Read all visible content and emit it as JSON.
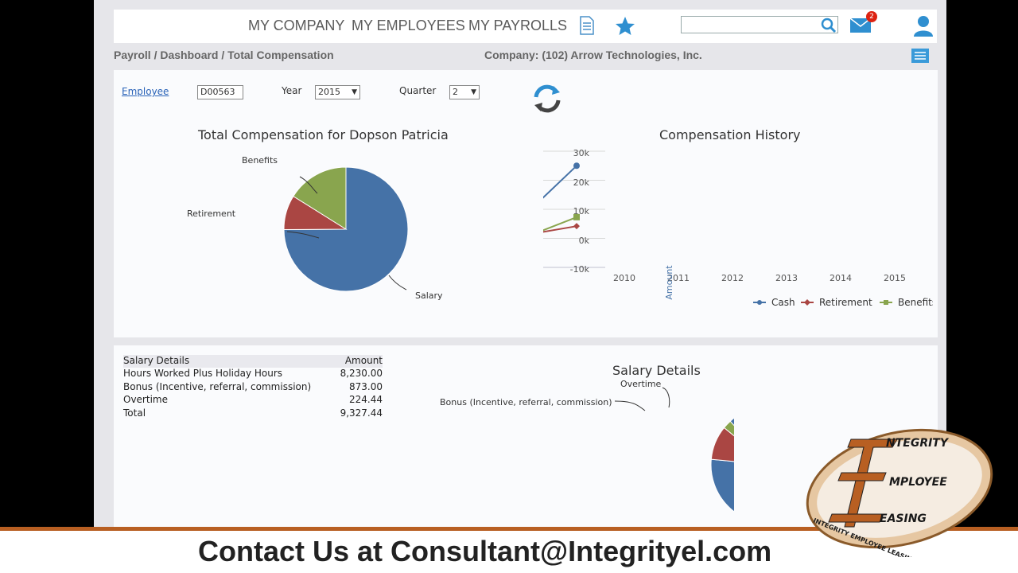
{
  "nav": {
    "links": [
      "MY COMPANY",
      "MY EMPLOYEES",
      "MY PAYROLLS"
    ],
    "icons": [
      "document-icon",
      "star-icon",
      "search-icon",
      "mail-icon",
      "user-icon"
    ],
    "mail_badge": "2",
    "search_value": ""
  },
  "breadcrumb": "Payroll / Dashboard / Total Compensation",
  "company": "Company: (102) Arrow Technologies, Inc.",
  "filters": {
    "employee_label": "Employee",
    "employee_value": "D00563",
    "year_label": "Year",
    "year_value": "2015",
    "quarter_label": "Quarter",
    "quarter_value": "2"
  },
  "pie1": {
    "title": "Total Compensation for Dopson Patricia",
    "labels": [
      "Salary",
      "Retirement",
      "Benefits"
    ]
  },
  "history": {
    "title": "Compensation History",
    "ylabel": "Amount",
    "yticks": [
      "30k",
      "20k",
      "10k",
      "0k",
      "-10k"
    ],
    "xticks": [
      "2010",
      "2011",
      "2012",
      "2013",
      "2014",
      "2015"
    ],
    "legend": [
      "Cash",
      "Retirement",
      "Benefits"
    ]
  },
  "salary_table": {
    "header": [
      "Salary Details",
      "Amount"
    ],
    "rows": [
      [
        "Hours Worked Plus Holiday Hours",
        "8,230.00"
      ],
      [
        "Bonus (Incentive, referral, commission)",
        "873.00"
      ],
      [
        "Overtime",
        "224.44"
      ],
      [
        "Total",
        "9,327.44"
      ]
    ]
  },
  "pie2": {
    "title": "Salary Details",
    "labels": [
      "Overtime",
      "Bonus (Incentive, referral, commission)"
    ]
  },
  "chart_data": [
    {
      "type": "pie",
      "title": "Total Compensation for Dopson Patricia",
      "categories": [
        "Salary",
        "Retirement",
        "Benefits"
      ],
      "values": [
        74.9,
        9.0,
        16.1
      ],
      "colors": [
        "#4572a7",
        "#aa4643",
        "#89a54e"
      ]
    },
    {
      "type": "line",
      "title": "Compensation History",
      "ylabel": "Amount",
      "x": [
        "2010",
        "2011",
        "2012",
        "2013",
        "2014",
        "2015"
      ],
      "ylim": [
        -10000,
        30000
      ],
      "grid": true,
      "legend": "bottom",
      "series": [
        {
          "name": "Cash",
          "color": "#4572a7",
          "values": [
            0,
            0,
            0,
            0,
            7300,
            25000
          ]
        },
        {
          "name": "Retirement",
          "color": "#aa4643",
          "values": [
            0,
            0,
            0,
            0,
            1000,
            4200
          ]
        },
        {
          "name": "Benefits",
          "color": "#89a54e",
          "values": [
            0,
            0,
            0,
            0,
            0,
            7300
          ]
        }
      ]
    },
    {
      "type": "pie",
      "title": "Salary Details",
      "categories": [
        "Hours Worked Plus Holiday Hours",
        "Bonus (Incentive, referral, commission)",
        "Overtime"
      ],
      "values": [
        8230.0,
        873.0,
        224.44
      ],
      "colors": [
        "#4572a7",
        "#aa4643",
        "#89a54e"
      ]
    }
  ],
  "logo": {
    "lines": [
      "NTEGRITY",
      "MPLOYEE",
      "EASING"
    ],
    "ring_text": "INTEGRITY EMPLOYEE LEASING"
  },
  "footer": "Contact Us at Consultant@Integrityel.com",
  "colors": {
    "accent": "#b85f22",
    "nav_icon": "#2f8fd0"
  }
}
